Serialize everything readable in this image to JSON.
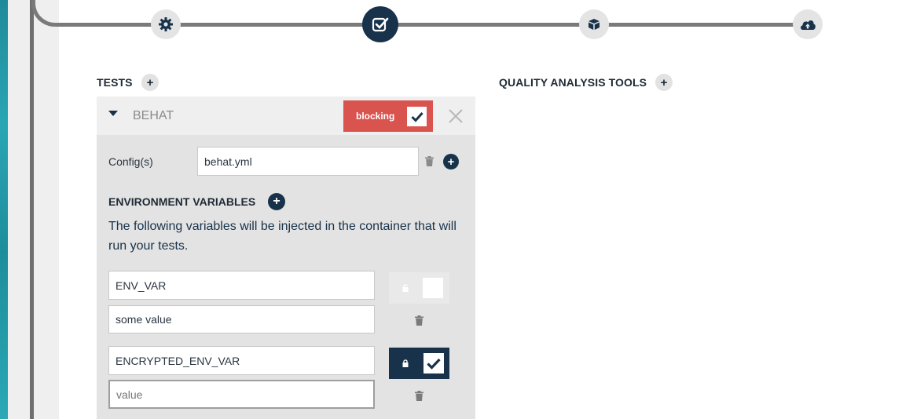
{
  "pipeline": {
    "steps": [
      {
        "name": "settings",
        "icon": "gear-icon",
        "active": false
      },
      {
        "name": "tests",
        "icon": "checkbox-icon",
        "active": true
      },
      {
        "name": "build",
        "icon": "package-icon",
        "active": false
      },
      {
        "name": "deploy",
        "icon": "cloud-upload-icon",
        "active": false
      }
    ]
  },
  "tests_section": {
    "title": "TESTS",
    "add_label": "+"
  },
  "quality_section": {
    "title": "QUALITY ANALYSIS TOOLS",
    "add_label": "+"
  },
  "test_card": {
    "name": "BEHAT",
    "blocking_label": "blocking",
    "blocking_checked": true,
    "config_label": "Config(s)",
    "config_value": "behat.yml",
    "add_config_label": "+",
    "env": {
      "title": "ENVIRONMENT VARIABLES",
      "add_label": "+",
      "description": "The following variables will be injected in the container that will run your tests.",
      "variables": [
        {
          "name": "ENV_VAR",
          "value": "some value",
          "encrypted": false
        },
        {
          "name": "ENCRYPTED_ENV_VAR",
          "value": "",
          "value_placeholder": "value",
          "encrypted": true
        }
      ]
    }
  },
  "colors": {
    "accent_dark": "#17324a",
    "blocking_red": "#d9534f",
    "card_bg": "#e3e3e3"
  }
}
